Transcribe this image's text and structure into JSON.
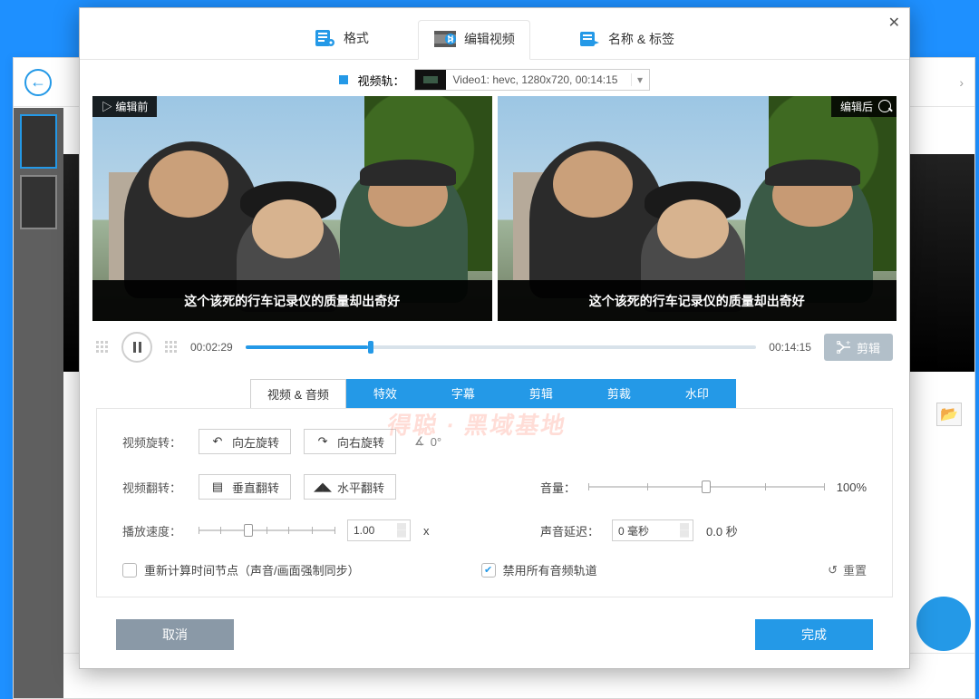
{
  "topnav": {
    "format": "格式",
    "edit": "编辑视频",
    "name_tags": "名称 & 标签"
  },
  "track": {
    "label": "视频轨：",
    "value": "Video1: hevc, 1280x720, 00:14:15"
  },
  "preview": {
    "before": "▷ 编辑前",
    "after": "编辑后",
    "subtitle": "这个该死的行车记录仪的质量却出奇好"
  },
  "playbar": {
    "current": "00:02:29",
    "total": "00:14:15",
    "cut": "剪辑"
  },
  "subtabs": [
    "视频 & 音频",
    "特效",
    "字幕",
    "剪辑",
    "剪裁",
    "水印"
  ],
  "panel": {
    "rotate_label": "视频旋转：",
    "rotate_left": "向左旋转",
    "rotate_right": "向右旋转",
    "angle": "0°",
    "flip_label": "视频翻转：",
    "flip_v": "垂直翻转",
    "flip_h": "水平翻转",
    "volume_label": "音量：",
    "volume_value": "100%",
    "speed_label": "播放速度：",
    "speed_value": "1.00",
    "speed_unit": "x",
    "delay_label": "声音延迟：",
    "delay_value": "0 毫秒",
    "delay_out": "0.0 秒",
    "resync": "重新计算时间节点（声音/画面强制同步）",
    "mute": "禁用所有音频轨道",
    "reset": "重置"
  },
  "actions": {
    "cancel": "取消",
    "ok": "完成"
  },
  "watermark": "得聪 · 黑域基地"
}
